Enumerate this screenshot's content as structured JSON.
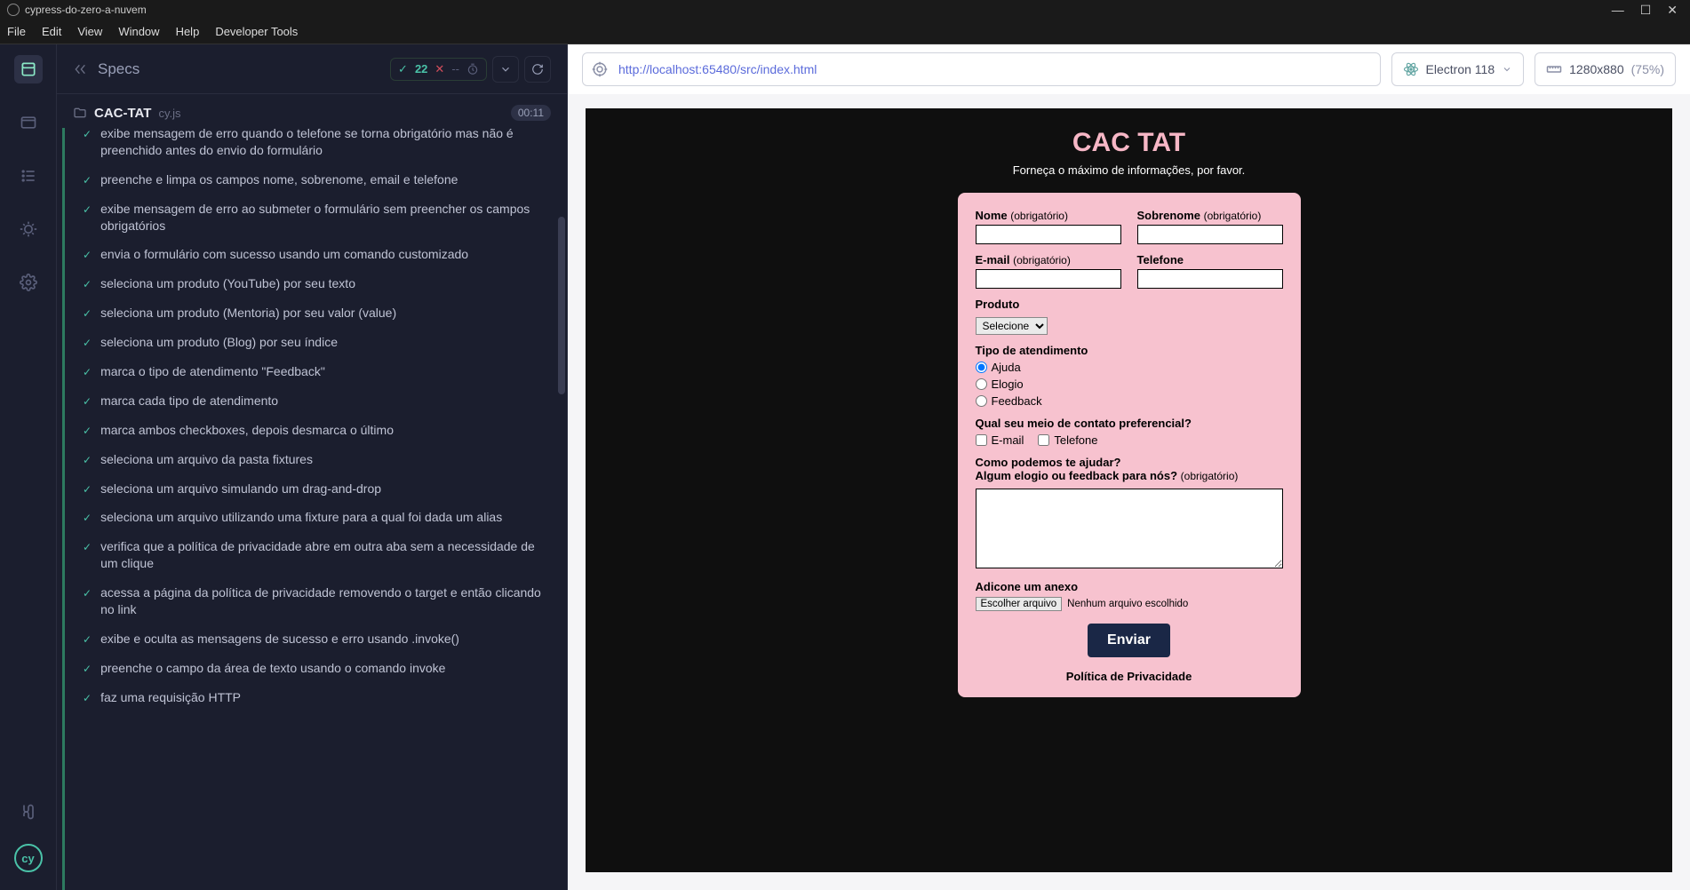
{
  "window": {
    "title": "cypress-do-zero-a-nuvem"
  },
  "menubar": [
    "File",
    "Edit",
    "View",
    "Window",
    "Help",
    "Developer Tools"
  ],
  "reporter": {
    "header_label": "Specs",
    "pass_count": "22",
    "spec_name": "CAC-TAT",
    "spec_file": "cy.js",
    "spec_time": "00:11",
    "tests": [
      "exibe mensagem de erro quando o telefone se torna obrigatório mas não é preenchido antes do envio do formulário",
      "preenche e limpa os campos nome, sobrenome, email e telefone",
      "exibe mensagem de erro ao submeter o formulário sem preencher os campos obrigatórios",
      "envia o formulário com sucesso usando um comando customizado",
      "seleciona um produto (YouTube) por seu texto",
      "seleciona um produto (Mentoria) por seu valor (value)",
      "seleciona um produto (Blog) por seu índice",
      "marca o tipo de atendimento \"Feedback\"",
      "marca cada tipo de atendimento",
      "marca ambos checkboxes, depois desmarca o último",
      "seleciona um arquivo da pasta fixtures",
      "seleciona um arquivo simulando um drag-and-drop",
      "seleciona um arquivo utilizando uma fixture para a qual foi dada um alias",
      "verifica que a política de privacidade abre em outra aba sem a necessidade de um clique",
      "acessa a página da política de privacidade removendo o target e então clicando no link",
      "exibe e oculta as mensagens de sucesso e erro usando .invoke()",
      "preenche o campo da área de texto usando o comando invoke",
      "faz uma requisição HTTP"
    ]
  },
  "aut": {
    "url": "http://localhost:65480/src/index.html",
    "browser": "Electron 118",
    "viewport": "1280x880",
    "scale": "(75%)"
  },
  "form": {
    "title": "CAC TAT",
    "subtitle": "Forneça o máximo de informações, por favor.",
    "nome_label": "Nome",
    "sobrenome_label": "Sobrenome",
    "email_label": "E-mail",
    "telefone_label": "Telefone",
    "obrigatorio": "(obrigatório)",
    "produto_label": "Produto",
    "produto_selected": "Selecione",
    "tipo_label": "Tipo de atendimento",
    "tipo_options": [
      "Ajuda",
      "Elogio",
      "Feedback"
    ],
    "contato_label": "Qual seu meio de contato preferencial?",
    "contato_email": "E-mail",
    "contato_telefone": "Telefone",
    "help_line1": "Como podemos te ajudar?",
    "help_line2": "Algum elogio ou feedback para nós?",
    "anexo_label": "Adicone um anexo",
    "file_button": "Escolher arquivo",
    "file_text": "Nenhum arquivo escolhido",
    "submit": "Enviar",
    "privacy": "Política de Privacidade"
  }
}
